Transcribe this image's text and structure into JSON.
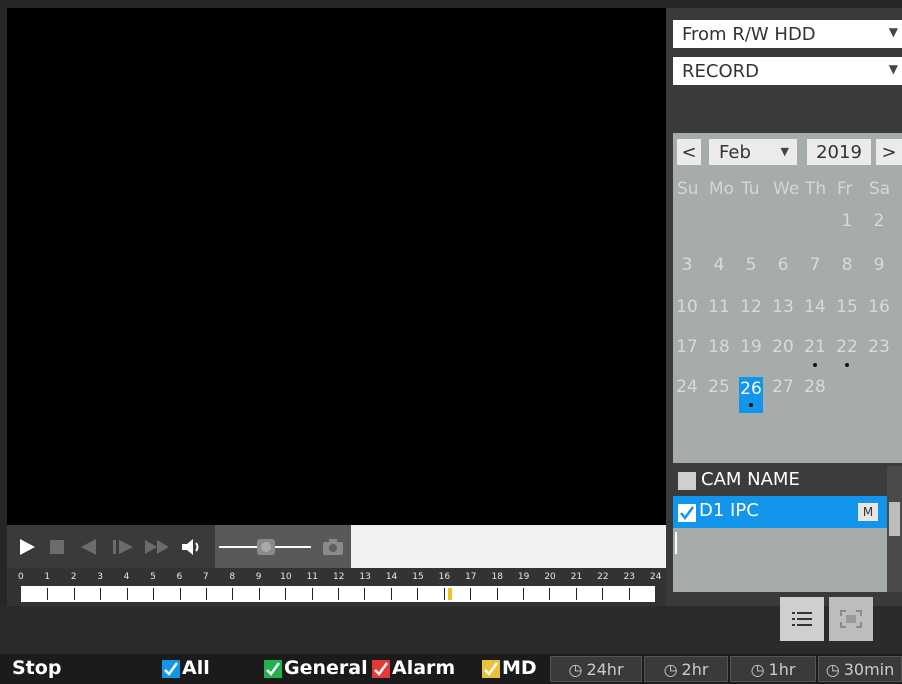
{
  "video": {
    "label": ""
  },
  "controls": {
    "play": "play-icon",
    "stop": "stop-icon",
    "reverse": "reverse-play-icon",
    "slow": "slow-play-icon",
    "fast": "fast-forward-icon",
    "volume": "volume-icon",
    "snapshot": "camera-icon"
  },
  "timeline": {
    "hours": [
      "0",
      "1",
      "2",
      "3",
      "4",
      "5",
      "6",
      "7",
      "8",
      "9",
      "10",
      "11",
      "12",
      "13",
      "14",
      "15",
      "16",
      "17",
      "18",
      "19",
      "20",
      "21",
      "22",
      "23",
      "24"
    ],
    "cursor_hour": 16.15,
    "cursor_color": "#f0c020"
  },
  "sidebar": {
    "source": {
      "value": "From R/W HDD"
    },
    "type": {
      "value": "RECORD"
    },
    "calendar": {
      "prev": "<",
      "next": ">",
      "month": "Feb",
      "year": "2019",
      "weekdays": [
        "Su",
        "Mo",
        "Tu",
        "We",
        "Th",
        "Fr",
        "Sa"
      ],
      "weeks": [
        [
          "",
          "",
          "",
          "",
          "",
          "1",
          "2"
        ],
        [
          "3",
          "4",
          "5",
          "6",
          "7",
          "8",
          "9"
        ],
        [
          "10",
          "11",
          "12",
          "13",
          "14",
          "15",
          "16"
        ],
        [
          "17",
          "18",
          "19",
          "20",
          "21",
          "22",
          "23"
        ],
        [
          "24",
          "25",
          "26",
          "27",
          "28",
          "",
          ""
        ]
      ],
      "selected_day": "26",
      "record_days": [
        "21",
        "22",
        "26"
      ],
      "accent": "#1296ec"
    },
    "channels": {
      "header": "CAM NAME",
      "items": [
        {
          "name": "D1 IPC",
          "badge": "M",
          "checked": true
        }
      ]
    },
    "buttons": [
      "list-icon",
      "fullscreen-icon"
    ]
  },
  "statusbar": {
    "state": "Stop",
    "filters": [
      {
        "label": "All",
        "color": "#1296ec",
        "checked": true
      },
      {
        "label": "General",
        "color": "#22b14c",
        "checked": true
      },
      {
        "label": "Alarm",
        "color": "#e53935",
        "checked": true
      },
      {
        "label": "MD",
        "color": "#e8c23a",
        "checked": true
      }
    ],
    "periods": [
      "24hr",
      "2hr",
      "1hr",
      "30min"
    ]
  }
}
